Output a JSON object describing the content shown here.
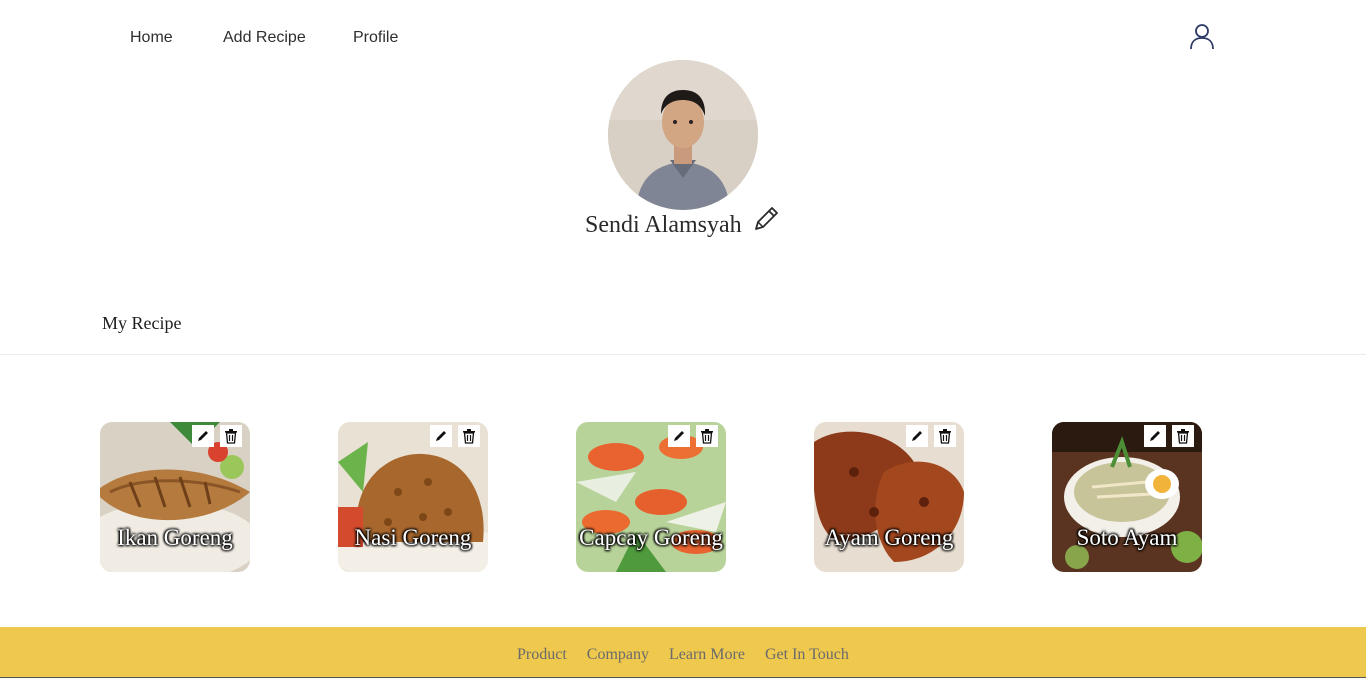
{
  "nav": {
    "links": [
      {
        "label": "Home"
      },
      {
        "label": "Add Recipe"
      },
      {
        "label": "Profile"
      }
    ],
    "user_icon": "user-outline-icon"
  },
  "profile": {
    "name": "Sendi Alamsyah",
    "edit_icon": "pencil-icon"
  },
  "section": {
    "title": "My Recipe"
  },
  "recipes": [
    {
      "title": "Ikan Goreng",
      "edit_icon": "pencil-icon",
      "delete_icon": "trash-icon"
    },
    {
      "title": "Nasi Goreng",
      "edit_icon": "pencil-icon",
      "delete_icon": "trash-icon"
    },
    {
      "title": "Capcay Goreng",
      "edit_icon": "pencil-icon",
      "delete_icon": "trash-icon"
    },
    {
      "title": "Ayam Goreng",
      "edit_icon": "pencil-icon",
      "delete_icon": "trash-icon"
    },
    {
      "title": "Soto Ayam",
      "edit_icon": "pencil-icon",
      "delete_icon": "trash-icon"
    }
  ],
  "footer": {
    "links": [
      "Product",
      "Company",
      "Learn More",
      "Get In Touch"
    ],
    "background": "#efc84e"
  }
}
